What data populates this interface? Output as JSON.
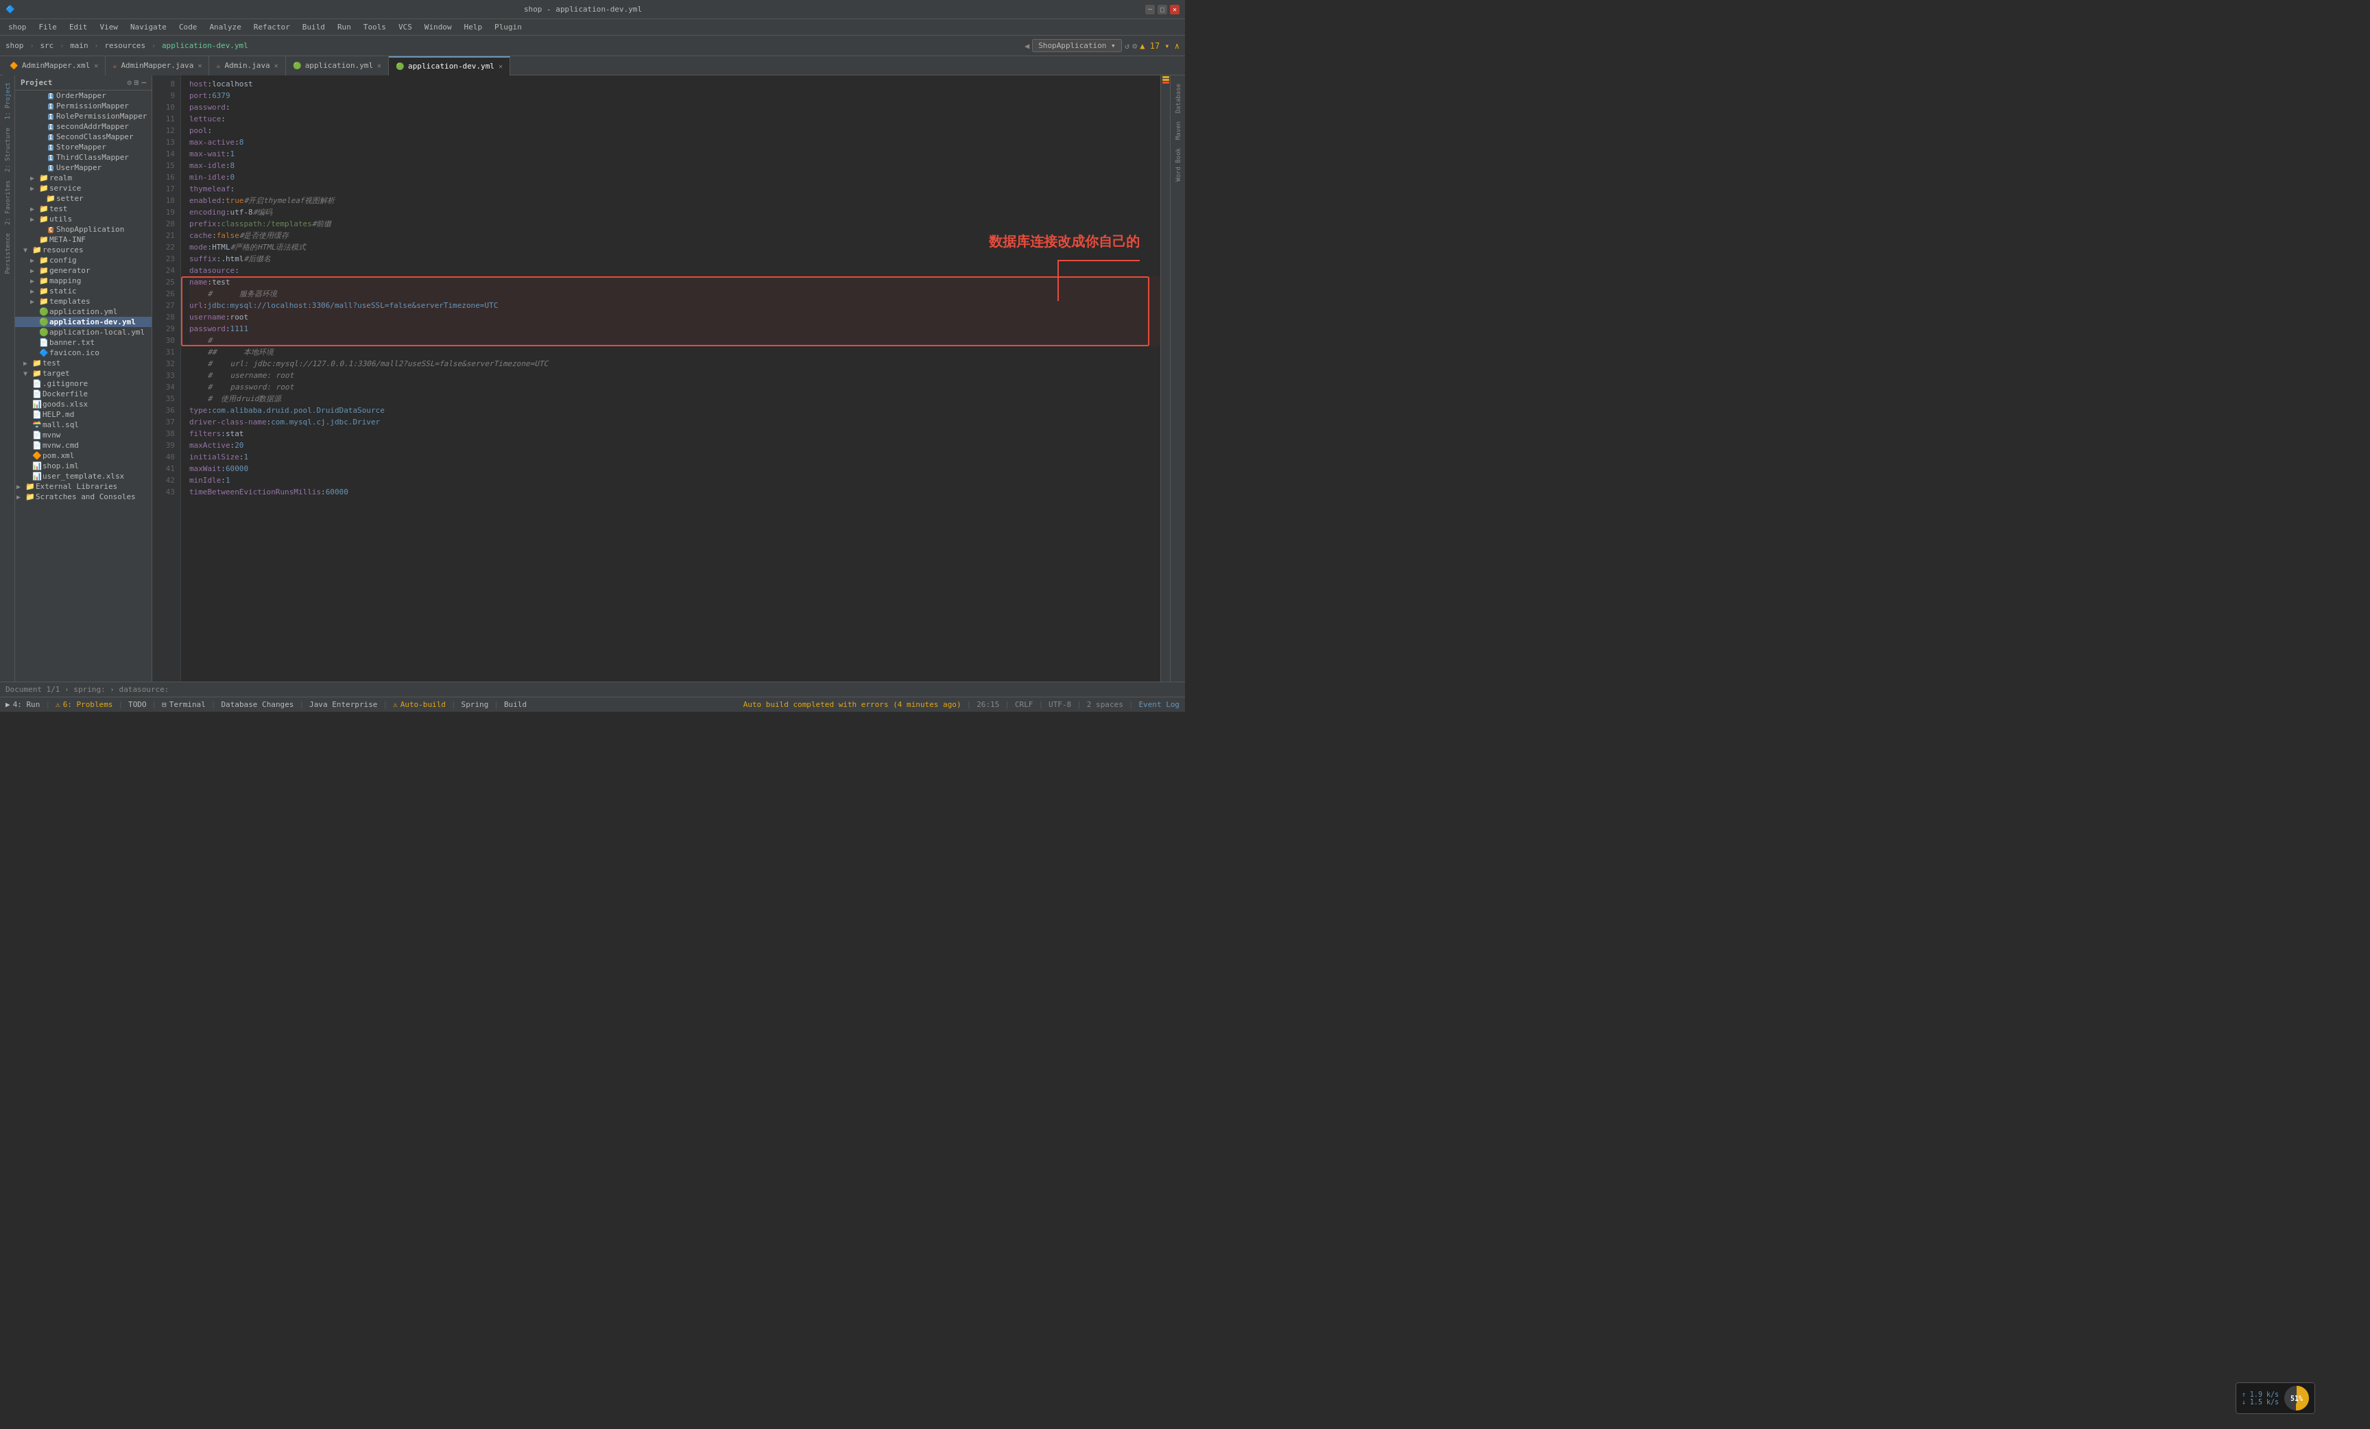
{
  "titlebar": {
    "title": "shop - application-dev.yml",
    "minimize": "─",
    "maximize": "□",
    "close": "✕"
  },
  "menubar": {
    "items": [
      "shop",
      "File",
      "Edit",
      "View",
      "Navigate",
      "Code",
      "Analyze",
      "Refactor",
      "Build",
      "Run",
      "Tools",
      "VCS",
      "Window",
      "Help",
      "Plugin"
    ]
  },
  "toolbar": {
    "breadcrumb": [
      "shop",
      "src",
      "main",
      "resources",
      "application-dev.yml"
    ],
    "run_config": "ShopApplication"
  },
  "tabs": [
    {
      "id": "adminmapper-xml",
      "label": "AdminMapper.xml",
      "type": "xml",
      "active": false
    },
    {
      "id": "adminmapper-java",
      "label": "AdminMapper.java",
      "type": "java",
      "active": false
    },
    {
      "id": "admin-java",
      "label": "Admin.java",
      "type": "java",
      "active": false
    },
    {
      "id": "application-yml",
      "label": "application.yml",
      "type": "yaml",
      "active": false
    },
    {
      "id": "application-dev-yml",
      "label": "application-dev.yml",
      "type": "yaml",
      "active": true
    }
  ],
  "sidebar": {
    "title": "Project",
    "tree": [
      {
        "indent": 3,
        "arrow": "",
        "icon": "I",
        "label": "OrderMapper",
        "type": "interface"
      },
      {
        "indent": 3,
        "arrow": "",
        "icon": "I",
        "label": "PermissionMapper",
        "type": "interface"
      },
      {
        "indent": 3,
        "arrow": "",
        "icon": "I",
        "label": "RolePermissionMapper",
        "type": "interface"
      },
      {
        "indent": 3,
        "arrow": "",
        "icon": "I",
        "label": "secondAddrMapper",
        "type": "interface"
      },
      {
        "indent": 3,
        "arrow": "",
        "icon": "I",
        "label": "SecondClassMapper",
        "type": "interface"
      },
      {
        "indent": 3,
        "arrow": "",
        "icon": "I",
        "label": "StoreMapper",
        "type": "interface"
      },
      {
        "indent": 3,
        "arrow": "",
        "icon": "I",
        "label": "ThirdClassMapper",
        "type": "interface"
      },
      {
        "indent": 3,
        "arrow": "",
        "icon": "I",
        "label": "UserMapper",
        "type": "interface"
      },
      {
        "indent": 2,
        "arrow": "▶",
        "icon": "📁",
        "label": "realm",
        "type": "folder"
      },
      {
        "indent": 2,
        "arrow": "▶",
        "icon": "📁",
        "label": "service",
        "type": "folder"
      },
      {
        "indent": 3,
        "arrow": "",
        "icon": "📁",
        "label": "setter",
        "type": "folder"
      },
      {
        "indent": 2,
        "arrow": "▶",
        "icon": "📁",
        "label": "test",
        "type": "folder"
      },
      {
        "indent": 2,
        "arrow": "▶",
        "icon": "📁",
        "label": "utils",
        "type": "folder"
      },
      {
        "indent": 3,
        "arrow": "",
        "icon": "🏠",
        "label": "ShopApplication",
        "type": "class"
      },
      {
        "indent": 2,
        "arrow": "",
        "icon": "📄",
        "label": "META-INF",
        "type": "folder"
      },
      {
        "indent": 1,
        "arrow": "▼",
        "icon": "📁",
        "label": "resources",
        "type": "folder"
      },
      {
        "indent": 2,
        "arrow": "▶",
        "icon": "📁",
        "label": "config",
        "type": "folder"
      },
      {
        "indent": 2,
        "arrow": "▶",
        "icon": "📁",
        "label": "generator",
        "type": "folder"
      },
      {
        "indent": 2,
        "arrow": "▶",
        "icon": "📁",
        "label": "mapping",
        "type": "folder"
      },
      {
        "indent": 2,
        "arrow": "▶",
        "icon": "📁",
        "label": "static",
        "type": "folder"
      },
      {
        "indent": 2,
        "arrow": "▶",
        "icon": "📁",
        "label": "templates",
        "type": "folder"
      },
      {
        "indent": 2,
        "arrow": "",
        "icon": "🟢",
        "label": "application.yml",
        "type": "yaml"
      },
      {
        "indent": 2,
        "arrow": "",
        "icon": "🟢",
        "label": "application-dev.yml",
        "type": "yaml",
        "selected": true
      },
      {
        "indent": 2,
        "arrow": "",
        "icon": "📄",
        "label": "application-local.yml",
        "type": "yaml"
      },
      {
        "indent": 2,
        "arrow": "",
        "icon": "📄",
        "label": "banner.txt",
        "type": "txt"
      },
      {
        "indent": 2,
        "arrow": "",
        "icon": "🔷",
        "label": "favicon.ico",
        "type": "ico"
      },
      {
        "indent": 1,
        "arrow": "▶",
        "icon": "📁",
        "label": "test",
        "type": "folder"
      },
      {
        "indent": 1,
        "arrow": "▼",
        "icon": "📁",
        "label": "target",
        "type": "folder"
      },
      {
        "indent": 1,
        "arrow": "",
        "icon": "📄",
        "label": ".gitignore",
        "type": "txt"
      },
      {
        "indent": 1,
        "arrow": "",
        "icon": "📄",
        "label": "Dockerfile",
        "type": "txt"
      },
      {
        "indent": 1,
        "arrow": "",
        "icon": "📊",
        "label": "goods.xlsx",
        "type": "file"
      },
      {
        "indent": 1,
        "arrow": "",
        "icon": "📄",
        "label": "HELP.md",
        "type": "md"
      },
      {
        "indent": 1,
        "arrow": "",
        "icon": "🗃️",
        "label": "mall.sql",
        "type": "sql"
      },
      {
        "indent": 1,
        "arrow": "",
        "icon": "📄",
        "label": "mvnw",
        "type": "txt"
      },
      {
        "indent": 1,
        "arrow": "",
        "icon": "📄",
        "label": "mvnw.cmd",
        "type": "txt"
      },
      {
        "indent": 1,
        "arrow": "",
        "icon": "🔴",
        "label": "pom.xml",
        "type": "xml"
      },
      {
        "indent": 1,
        "arrow": "",
        "icon": "📊",
        "label": "shop.iml",
        "type": "file"
      },
      {
        "indent": 1,
        "arrow": "",
        "icon": "📊",
        "label": "user_template.xlsx",
        "type": "file"
      },
      {
        "indent": 0,
        "arrow": "▶",
        "icon": "📁",
        "label": "External Libraries",
        "type": "folder"
      },
      {
        "indent": 0,
        "arrow": "▶",
        "icon": "📄",
        "label": "Scratches and Consoles",
        "type": "folder"
      }
    ]
  },
  "code": {
    "lines": [
      {
        "num": 8,
        "content": "    host: localhost"
      },
      {
        "num": 9,
        "content": "    port: 6379"
      },
      {
        "num": 10,
        "content": "    password:"
      },
      {
        "num": 11,
        "content": "    lettuce:"
      },
      {
        "num": 12,
        "content": "      pool:"
      },
      {
        "num": 13,
        "content": "        max-active: 8"
      },
      {
        "num": 14,
        "content": "        max-wait: 1"
      },
      {
        "num": 15,
        "content": "        max-idle: 8"
      },
      {
        "num": 16,
        "content": "        min-idle: 0"
      },
      {
        "num": 17,
        "content": "  thymeleaf:"
      },
      {
        "num": 18,
        "content": "    enabled: true  #开启thymeleaf视图解析"
      },
      {
        "num": 19,
        "content": "    encoding: utf-8  #编码"
      },
      {
        "num": 20,
        "content": "    prefix: classpath:/templates  #前缀"
      },
      {
        "num": 21,
        "content": "    cache: false  #是否使用缓存"
      },
      {
        "num": 22,
        "content": "    mode: HTML  #严格的HTML语法模式"
      },
      {
        "num": 23,
        "content": "    suffix: .html  #后缀名"
      },
      {
        "num": 24,
        "content": "  datasource:"
      },
      {
        "num": 25,
        "content": "    name: test"
      },
      {
        "num": 26,
        "content": "    #      服务器环境"
      },
      {
        "num": 27,
        "content": "    url: jdbc:mysql://localhost:3306/mall?useSSL=false&serverTimezone=UTC"
      },
      {
        "num": 28,
        "content": "    username: root"
      },
      {
        "num": 29,
        "content": "    password: 1111"
      },
      {
        "num": 30,
        "content": "    #"
      },
      {
        "num": 31,
        "content": "    ##      本地环境"
      },
      {
        "num": 32,
        "content": "    #    url: jdbc:mysql://127.0.0.1:3306/mall2?useSSL=false&serverTimezone=UTC"
      },
      {
        "num": 33,
        "content": "    #    username: root"
      },
      {
        "num": 34,
        "content": "    #    password: root"
      },
      {
        "num": 35,
        "content": "    #  使用druid数据源"
      },
      {
        "num": 36,
        "content": "    type: com.alibaba.druid.pool.DruidDataSource"
      },
      {
        "num": 37,
        "content": "    driver-class-name: com.mysql.cj.jdbc.Driver"
      },
      {
        "num": 38,
        "content": "    filters: stat"
      },
      {
        "num": 39,
        "content": "    maxActive: 20"
      },
      {
        "num": 40,
        "content": "    initialSize: 1"
      },
      {
        "num": 41,
        "content": "    maxWait: 60000"
      },
      {
        "num": 42,
        "content": "    minIdle: 1"
      },
      {
        "num": 43,
        "content": "    timeBetweenEvictionRunsMillis: 60000"
      }
    ]
  },
  "annotation": {
    "text": "数据库连接改成你自己的",
    "color": "#e74c3c"
  },
  "status_breadcrumb": {
    "text": "Document 1/1  ›  spring:  ›  datasource:"
  },
  "statusbar": {
    "run_label": "4: Run",
    "problems_label": "6: Problems",
    "todo_label": "TODO",
    "terminal_label": "Terminal",
    "db_label": "Database Changes",
    "java_label": "Java Enterprise",
    "autobuild_label": "Auto-build",
    "spring_label": "Spring",
    "build_label": "Build",
    "position": "26:15",
    "line_sep": "CRLF",
    "encoding": "UTF-8",
    "indent": "2 spaces",
    "event_log": "Event Log",
    "autobuild_status": "Auto build completed with errors (4 minutes ago)"
  },
  "network": {
    "up": "1.9 k/s",
    "down": "1.5 k/s",
    "cpu": "51%"
  }
}
